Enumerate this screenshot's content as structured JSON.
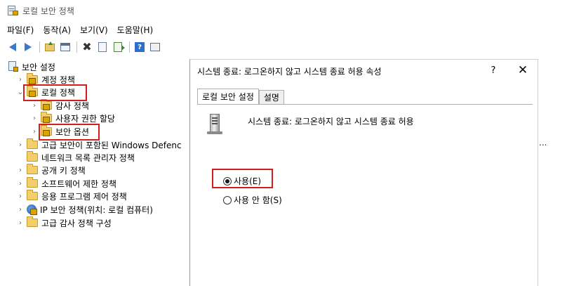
{
  "window": {
    "title": "로컬 보안 정책"
  },
  "menu": {
    "items": [
      "파일(F)",
      "동작(A)",
      "보기(V)",
      "도움말(H)"
    ]
  },
  "toolbar": {
    "help_label": "?"
  },
  "tree": {
    "root": "보안 설정",
    "account_policy": "계정 정책",
    "local_policy": "로컬 정책",
    "audit_policy": "감사 정책",
    "user_rights": "사용자 권한 할당",
    "security_options": "보안 옵션",
    "defender_firewall": "고급 보안이 포함된 Windows Defenc",
    "network_list": "네트워크 목록 관리자 정책",
    "public_key": "공개 키 정책",
    "software_restriction": "소프트웨어 제한 정책",
    "app_control": "응용 프로그램 제어 정책",
    "ip_security": "IP 보안 정책(위치: 로컬 컴퓨터)",
    "advanced_audit": "고급 감사 정책 구성"
  },
  "dialog": {
    "title": "시스템 종료: 로그온하지 않고 시스템 종료 허용 속성",
    "help": "?",
    "close": "✕",
    "tabs": [
      "로컬 보안 설정",
      "설명"
    ],
    "policy_name": "시스템 종료: 로그온하지 않고 시스템 종료 허용",
    "options": {
      "enabled": "사용(E)",
      "disabled": "사용 안 함(S)"
    },
    "selected": "enabled"
  },
  "list_overflow": "..."
}
